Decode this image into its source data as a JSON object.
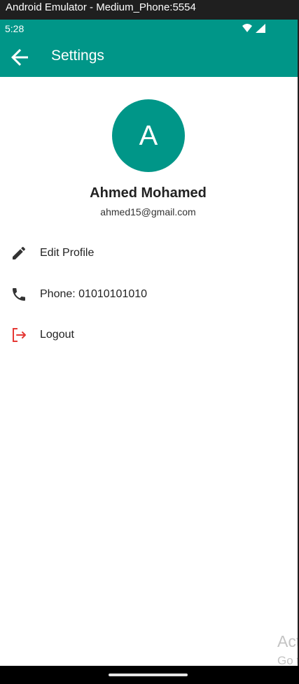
{
  "window": {
    "title": "Android Emulator - Medium_Phone:5554"
  },
  "status_bar": {
    "time": "5:28",
    "icons": [
      "wifi-icon",
      "signal-icon"
    ]
  },
  "app_bar": {
    "title": "Settings",
    "back_icon": "arrow-back-icon"
  },
  "profile": {
    "avatar_letter": "A",
    "name": "Ahmed Mohamed",
    "email": "ahmed15@gmail.com"
  },
  "menu": {
    "items": [
      {
        "label": "Edit Profile",
        "icon": "edit-pencil-icon"
      },
      {
        "label": "Phone: 01010101010",
        "icon": "phone-icon"
      },
      {
        "label": "Logout",
        "icon": "logout-icon"
      }
    ]
  },
  "watermark": {
    "line1": "Act",
    "line2": "Go t"
  },
  "colors": {
    "primary": "#009688",
    "logout_icon": "#e53935",
    "text": "#222222",
    "icon_dark": "#333333"
  }
}
